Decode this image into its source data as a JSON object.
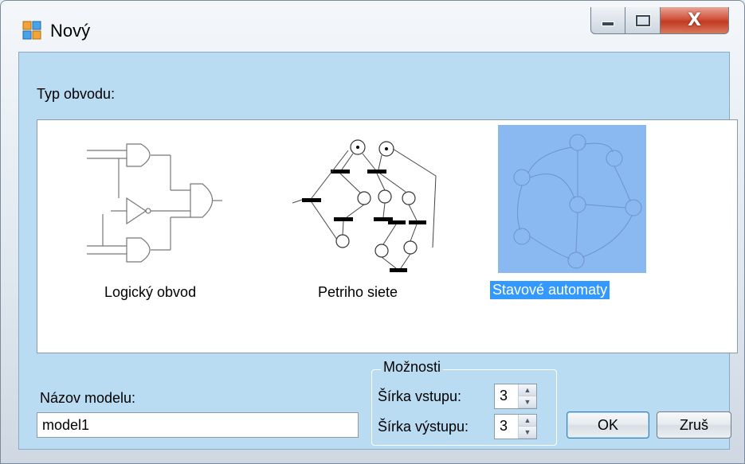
{
  "window": {
    "title": "Nový",
    "icon": "app-window-icon"
  },
  "caption": {
    "minimize_icon": "minimize-icon",
    "maximize_icon": "maximize-icon",
    "close_glyph": "X"
  },
  "type_label": "Typ obvodu:",
  "circuit_types": [
    {
      "label": "Logický obvod",
      "icon": "logic-circuit-icon",
      "selected": false
    },
    {
      "label": "Petriho siete",
      "icon": "petri-net-icon",
      "selected": false
    },
    {
      "label": "Stavové automaty",
      "icon": "state-machine-icon",
      "selected": true
    }
  ],
  "model_name": {
    "label": "Názov modelu:",
    "value": "model1"
  },
  "options": {
    "title": "Možnosti",
    "input_width": {
      "label": "Šírka vstupu:",
      "value": "3"
    },
    "output_width": {
      "label": "Šírka výstupu:",
      "value": "3"
    }
  },
  "buttons": {
    "ok": "OK",
    "cancel": "Zruš"
  },
  "colors": {
    "client_bg": "#b9dcf3",
    "selection": "#3399ff",
    "close_red": "#c9452c"
  }
}
